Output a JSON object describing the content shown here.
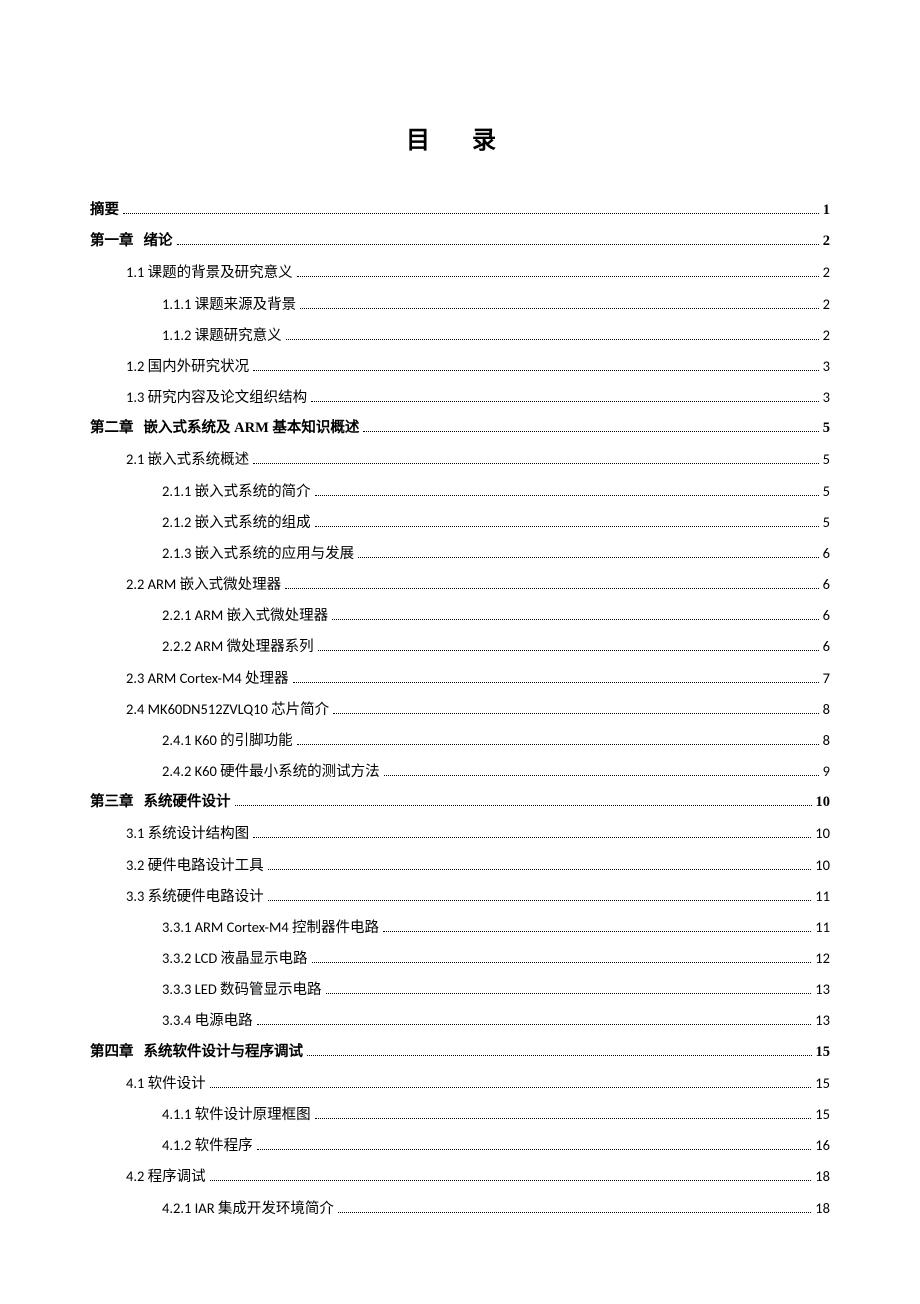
{
  "title": "目 录",
  "toc": [
    {
      "label": "摘要",
      "page": "1",
      "level": 0,
      "bold": true
    },
    {
      "chapter": "第一章",
      "label": "绪论",
      "page": "2",
      "level": 0,
      "bold": true
    },
    {
      "label": "1.1 课题的背景及研究意义",
      "page": "2",
      "level": 1
    },
    {
      "label": "1.1.1 课题来源及背景",
      "page": "2",
      "level": 2
    },
    {
      "label": "1.1.2 课题研究意义",
      "page": "2",
      "level": 2
    },
    {
      "label": "1.2 国内外研究状况",
      "page": "3",
      "level": 1
    },
    {
      "label": "1.3 研究内容及论文组织结构",
      "page": "3",
      "level": 1
    },
    {
      "chapter": "第二章",
      "label": "嵌入式系统及 ARM 基本知识概述",
      "page": "5",
      "level": 0,
      "bold": true
    },
    {
      "label": "2.1 嵌入式系统概述",
      "page": "5",
      "level": 1
    },
    {
      "label": "2.1.1 嵌入式系统的简介",
      "page": "5",
      "level": 2
    },
    {
      "label": "2.1.2 嵌入式系统的组成",
      "page": "5",
      "level": 2
    },
    {
      "label": "2.1.3 嵌入式系统的应用与发展",
      "page": "6",
      "level": 2
    },
    {
      "label": "2.2 ARM 嵌入式微处理器",
      "page": "6",
      "level": 1
    },
    {
      "label": "2.2.1 ARM 嵌入式微处理器",
      "page": "6",
      "level": 2
    },
    {
      "label": "2.2.2 ARM 微处理器系列",
      "page": "6",
      "level": 2
    },
    {
      "label": "2.3 ARM Cortex-M4 处理器",
      "page": "7",
      "level": 1
    },
    {
      "label": "2.4 MK60DN512ZVLQ10 芯片简介",
      "page": "8",
      "level": 1
    },
    {
      "label": "2.4.1 K60 的引脚功能",
      "page": "8",
      "level": 2
    },
    {
      "label": "2.4.2 K60 硬件最小系统的测试方法",
      "page": "9",
      "level": 2
    },
    {
      "chapter": "第三章",
      "label": "系统硬件设计",
      "page": "10",
      "level": 0,
      "bold": true
    },
    {
      "label": "3.1 系统设计结构图",
      "page": "10",
      "level": 1
    },
    {
      "label": "3.2 硬件电路设计工具",
      "page": "10",
      "level": 1
    },
    {
      "label": "3.3 系统硬件电路设计",
      "page": "11",
      "level": 1
    },
    {
      "label": "3.3.1 ARM Cortex-M4 控制器件电路",
      "page": "11",
      "level": 2
    },
    {
      "label": "3.3.2 LCD 液晶显示电路",
      "page": "12",
      "level": 2
    },
    {
      "label": "3.3.3 LED 数码管显示电路",
      "page": "13",
      "level": 2
    },
    {
      "label": "3.3.4 电源电路",
      "page": "13",
      "level": 2
    },
    {
      "chapter": "第四章",
      "label": "系统软件设计与程序调试",
      "page": "15",
      "level": 0,
      "bold": true
    },
    {
      "label": "4.1 软件设计",
      "page": "15",
      "level": 1
    },
    {
      "label": "4.1.1 软件设计原理框图",
      "page": "15",
      "level": 2
    },
    {
      "label": "4.1.2 软件程序",
      "page": "16",
      "level": 2
    },
    {
      "label": "4.2 程序调试",
      "page": "18",
      "level": 1
    },
    {
      "label": "4.2.1 IAR 集成开发环境简介",
      "page": "18",
      "level": 2
    }
  ]
}
